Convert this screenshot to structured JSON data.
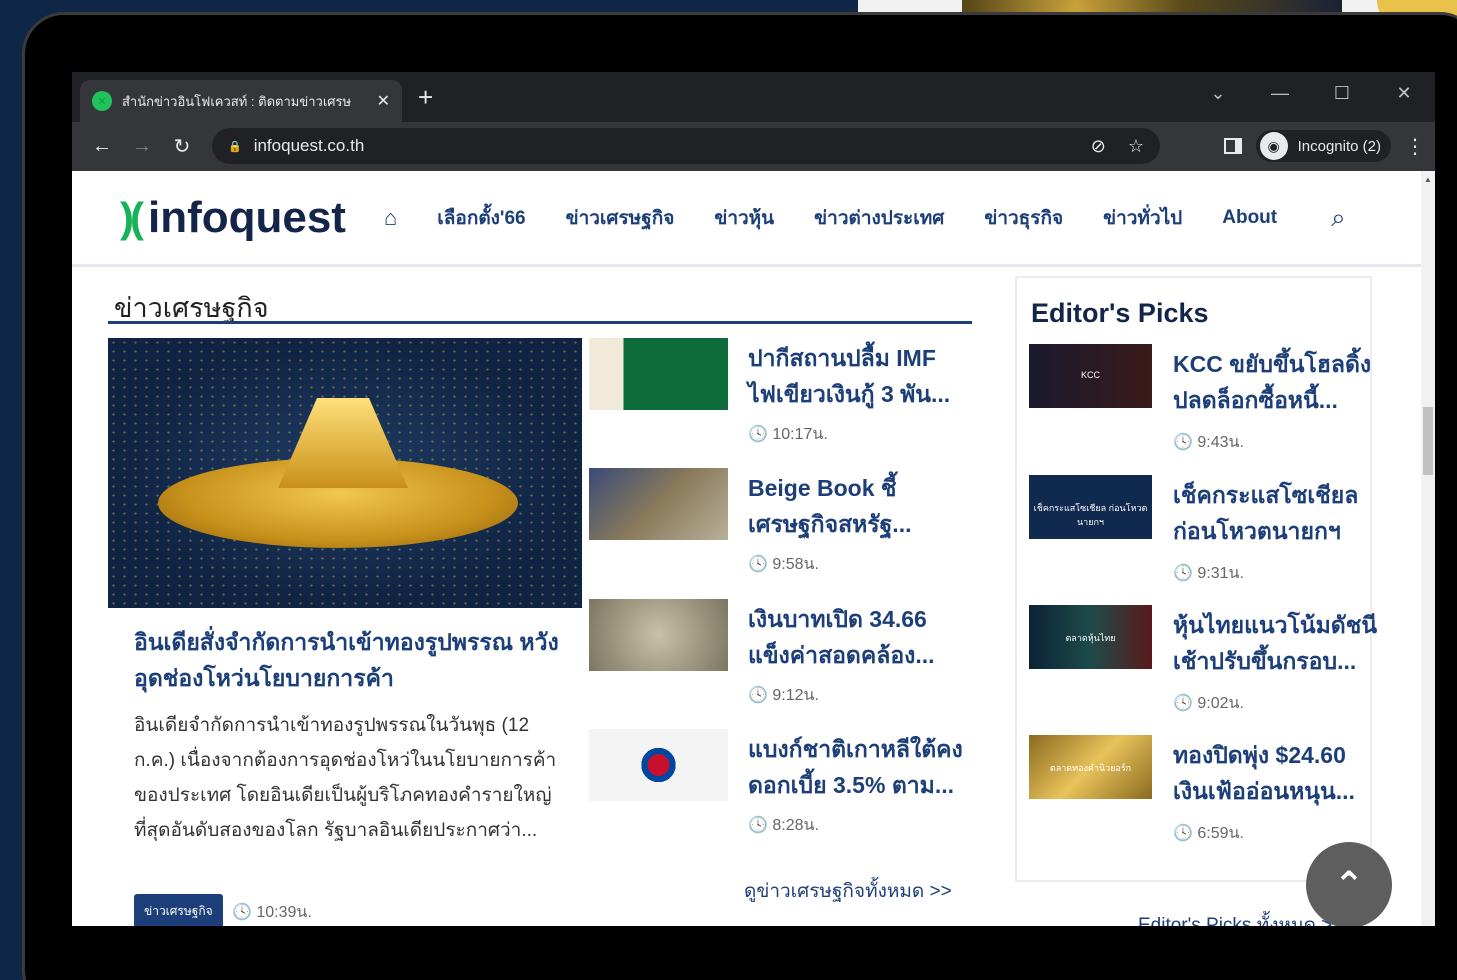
{
  "browser": {
    "tab_title": "สำนักข่าวอินโฟเควสท์ : ติดตามข่าวเศรษ",
    "url": "infoquest.co.th",
    "incognito_label": "Incognito (2)"
  },
  "site": {
    "logo_text": "infoquest",
    "nav": [
      "เลือกตั้ง'66",
      "ข่าวเศรษฐกิจ",
      "ข่าวหุ้น",
      "ข่าวต่างประเทศ",
      "ข่าวธุรกิจ",
      "ข่าวทั่วไป",
      "About"
    ]
  },
  "section": {
    "title": "ข่าวเศรษฐกิจ",
    "hero": {
      "title": "อินเดียสั่งจำกัดการนำเข้าทองรูปพรรณ หวังอุดช่องโหว่นโยบายการค้า",
      "desc": "อินเดียจำกัดการนำเข้าทองรูปพรรณในวันพุธ (12 ก.ค.) เนื่องจากต้องการอุดช่องโหว่ในนโยบายการค้าของประเทศ โดยอินเดียเป็นผู้บริโภคทองคำรายใหญ่ที่สุดอันดับสองของโลก รัฐบาลอินเดียประกาศว่า...",
      "badge": "ข่าวเศรษฐกิจ",
      "time": "🕓 10:39น."
    },
    "items": [
      {
        "line1": "ปากีสถานปลื้ม IMF",
        "line2": "ไฟเขียวเงินกู้ 3 พัน...",
        "time": "🕓 10:17น."
      },
      {
        "line1": "Beige Book ชี้",
        "line2": "เศรษฐกิจสหรัฐ...",
        "time": "🕓 9:58น."
      },
      {
        "line1": "เงินบาทเปิด 34.66",
        "line2": "แข็งค่าสอดคล้อง...",
        "time": "🕓 9:12น."
      },
      {
        "line1": "แบงก์ชาติเกาหลีใต้คง",
        "line2": "ดอกเบี้ย 3.5% ตาม...",
        "time": "🕓 8:28น."
      }
    ],
    "see_all": "ดูข่าวเศรษฐกิจทั้งหมด >>"
  },
  "editor": {
    "title": "Editor's Picks",
    "items": [
      {
        "line1": "KCC ขยับขึ้นโฮลดิ้ง",
        "line2": "ปลดล็อกซื้อหนี้...",
        "time": "🕓 9:43น.",
        "thumb_text": "KCC"
      },
      {
        "line1": "เช็คกระแสโซเชียล",
        "line2": "ก่อนโหวตนายกฯ",
        "time": "🕓 9:31น.",
        "thumb_text": "เช็คกระแสโซเชียล ก่อนโหวตนายกฯ"
      },
      {
        "line1": "หุ้นไทยแนวโน้มดัชนี",
        "line2": "เช้าปรับขึ้นกรอบ...",
        "time": "🕓 9:02น.",
        "thumb_text": "ตลาดหุ้นไทย"
      },
      {
        "line1": "ทองปิดพุ่ง $24.60",
        "line2": "เงินเฟ้ออ่อนหนุน...",
        "time": "🕓 6:59น.",
        "thumb_text": "ตลาดทองคำนิวยอร์ก"
      }
    ],
    "more": "Editor's Picks ทั้งหมด >>"
  },
  "colors": {
    "brand_navy": "#1d3f79",
    "brand_green": "#16b35a"
  },
  "icons": [
    "home-icon",
    "search-icon",
    "back-icon",
    "forward-icon",
    "reload-icon",
    "lock-icon",
    "star-icon",
    "eye-off-icon",
    "incognito-icon",
    "scroll-top-icon"
  ]
}
